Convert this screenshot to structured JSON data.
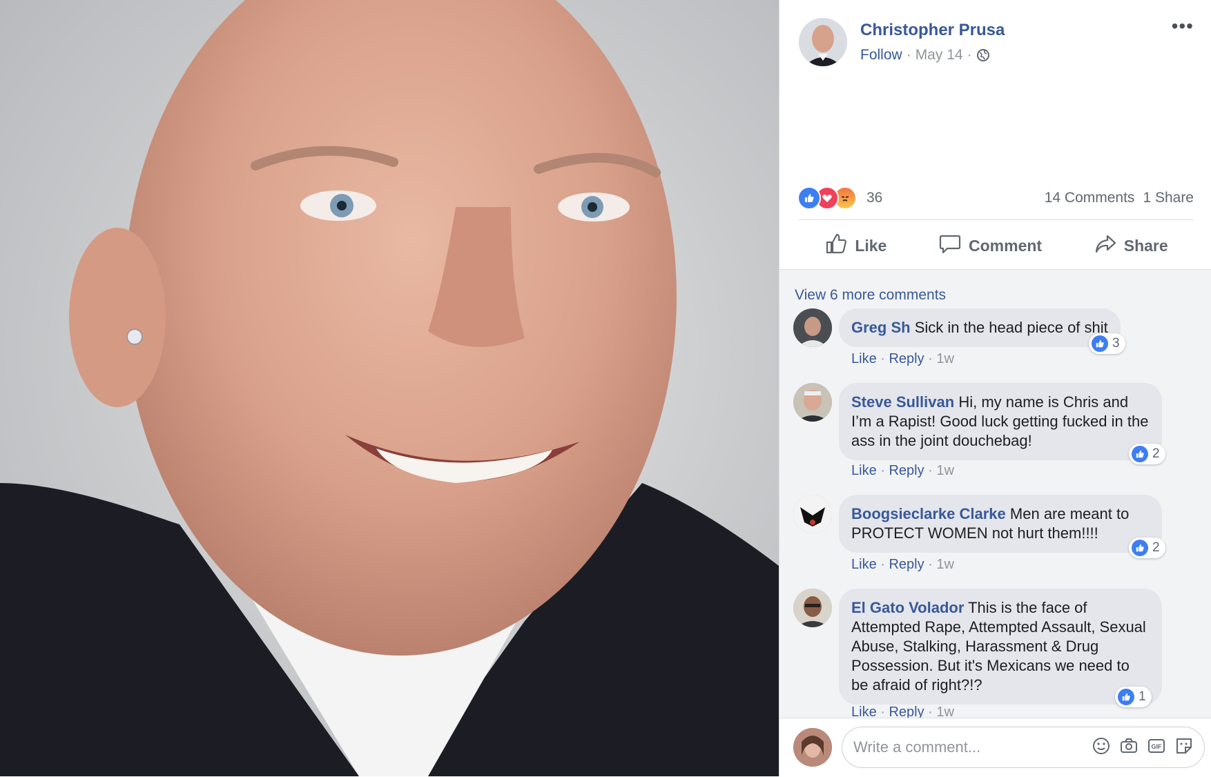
{
  "post": {
    "author_name": "Christopher Prusa",
    "follow_label": "Follow",
    "separator": "·",
    "date": "May 14",
    "more_icon": "ellipsis-icon",
    "privacy_icon": "globe-icon"
  },
  "reactions": {
    "types": [
      "like",
      "love",
      "angry"
    ],
    "count": "36",
    "comments_label": "14 Comments",
    "shares_label": "1 Share"
  },
  "actions": {
    "like": "Like",
    "comment": "Comment",
    "share": "Share"
  },
  "comments_section": {
    "view_more": "View 6 more comments",
    "items": [
      {
        "author": "Greg Sh",
        "text": "Sick in the head piece of shit",
        "like": "Like",
        "reply": "Reply",
        "time": "1w",
        "reactions": "3"
      },
      {
        "author": "Steve Sullivan",
        "text": "Hi, my name is Chris and I’m a Rapist! Good luck getting fucked in the ass in the joint douchebag!",
        "like": "Like",
        "reply": "Reply",
        "time": "1w",
        "reactions": "2"
      },
      {
        "author": "Boogsieclarke Clarke",
        "text": "Men are meant to PROTECT WOMEN not hurt them!!!!",
        "like": "Like",
        "reply": "Reply",
        "time": "1w",
        "reactions": "2"
      },
      {
        "author": "El Gato Volador",
        "text": "This is the face of Attempted Rape, Attempted Assault, Sexual Abuse, Stalking, Harassment & Drug Possession. But it's Mexicans we need to be afraid of right?!?",
        "like": "Like",
        "reply": "Reply",
        "time": "1w",
        "reactions": "1"
      }
    ]
  },
  "composer": {
    "placeholder": "Write a comment...",
    "tool_icons": [
      "emoji-icon",
      "camera-icon",
      "gif-icon",
      "sticker-icon"
    ]
  },
  "colors": {
    "link_blue": "#385898",
    "like_blue": "#3d7ef3",
    "love_red": "#f0405c",
    "text_gray": "#606770",
    "comments_bg": "#f2f3f5"
  }
}
